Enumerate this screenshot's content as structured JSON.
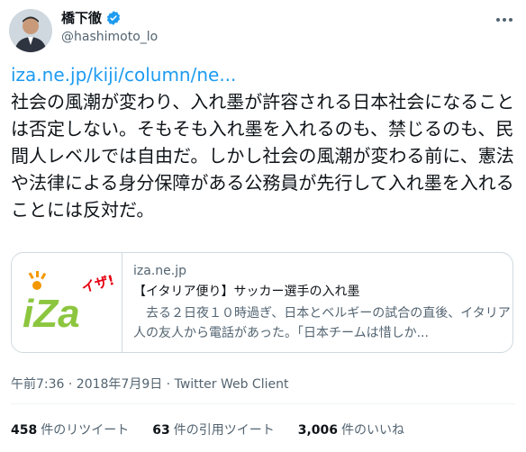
{
  "author": {
    "display_name": "橋下徹",
    "handle": "@hashimoto_lo"
  },
  "tweet": {
    "link_text": "iza.ne.jp/kiji/column/ne...",
    "body": "社会の風潮が変わり、入れ墨が許容される日本社会になることは否定しない。そもそも入れ墨を入れるのも、禁じるのも、民間人レベルでは自由だ。しかし社会の風潮が変わる前に、憲法や法律による身分保障がある公務員が先行して入れ墨を入れることには反対だ。"
  },
  "card": {
    "logo_text": "iZa",
    "logo_sub": "イザ!",
    "domain": "iza.ne.jp",
    "title": "【イタリア便り】サッカー選手の入れ墨",
    "description": "　去る２日夜１０時過ぎ、日本とベルギーの試合の直後、イタリア人の友人から電話があった。「日本チームは惜しか..."
  },
  "meta": {
    "timestamp": "午前7:36 · 2018年7月9日 · Twitter Web Client"
  },
  "stats": {
    "retweets": {
      "count": "458",
      "label": "件のリツイート"
    },
    "quotes": {
      "count": "63",
      "label": "件の引用ツイート"
    },
    "likes": {
      "count": "3,006",
      "label": "件のいいね"
    }
  },
  "colors": {
    "accent": "#1d9bf0",
    "secondary_text": "#536471",
    "border": "#cfd9de"
  }
}
